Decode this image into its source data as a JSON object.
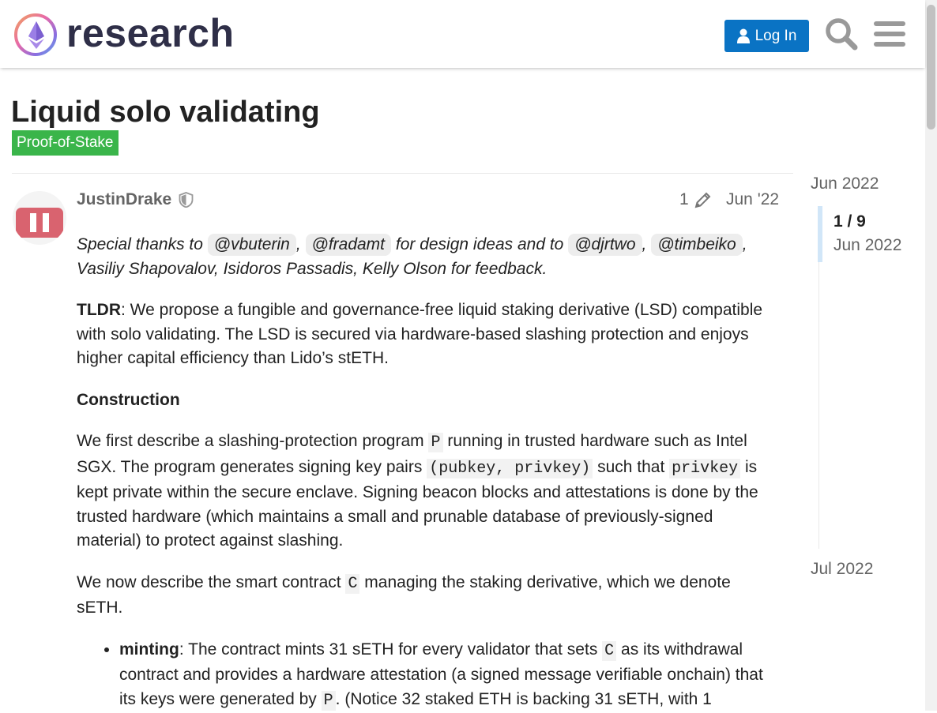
{
  "header": {
    "site_name": "research",
    "login_label": "Log In"
  },
  "topic": {
    "title": "Liquid solo validating",
    "category": "Proof-of-Stake",
    "category_color": "#3ab54a"
  },
  "post": {
    "author": "JustinDrake",
    "edit_count": "1",
    "date": "Jun '22",
    "thanks": {
      "prefix": "Special thanks to",
      "m1": "@vbuterin",
      "sep1": ",",
      "m2": "@fradamt",
      "mid": "for design ideas and to",
      "m3": "@djrtwo",
      "sep2": ",",
      "m4": "@timbeiko",
      "suffix": ", Vasiliy Shapovalov, Isidoros Passadis, Kelly Olson for feedback."
    },
    "tldr": {
      "label": "TLDR",
      "text": ": We propose a fungible and governance-free liquid staking derivative (LSD) compatible with solo validating. The LSD is secured via hardware-based slashing protection and enjoys higher capital efficiency than Lido’s stETH."
    },
    "construction_heading": "Construction",
    "p1": {
      "t1": "We first describe a slashing-protection program",
      "c1": "P",
      "t2": "running in trusted hardware such as Intel SGX. The program generates signing key pairs",
      "c2": "(pubkey, privkey)",
      "t3": "such that",
      "c3": "privkey",
      "t4": "is kept private within the secure enclave. Signing beacon blocks and attestations is done by the trusted hardware (which maintains a small and prunable database of previously-signed material) to protect against slashing."
    },
    "p2": {
      "t1": "We now describe the smart contract",
      "c1": "C",
      "t2": "managing the staking derivative, which we denote sETH."
    },
    "bullet1": {
      "label": "minting",
      "t1": ": The contract mints 31 sETH for every validator that sets",
      "c1": "C",
      "t2": "as its withdrawal contract and provides a hardware attestation (a signed message verifiable onchain) that its keys were generated by",
      "c2": "P",
      "t3": ". (Notice 32 staked ETH is backing 31 sETH, with 1"
    }
  },
  "timeline": {
    "start": "Jun 2022",
    "position": "1 / 9",
    "current_date": "Jun 2022",
    "end": "Jul 2022"
  }
}
